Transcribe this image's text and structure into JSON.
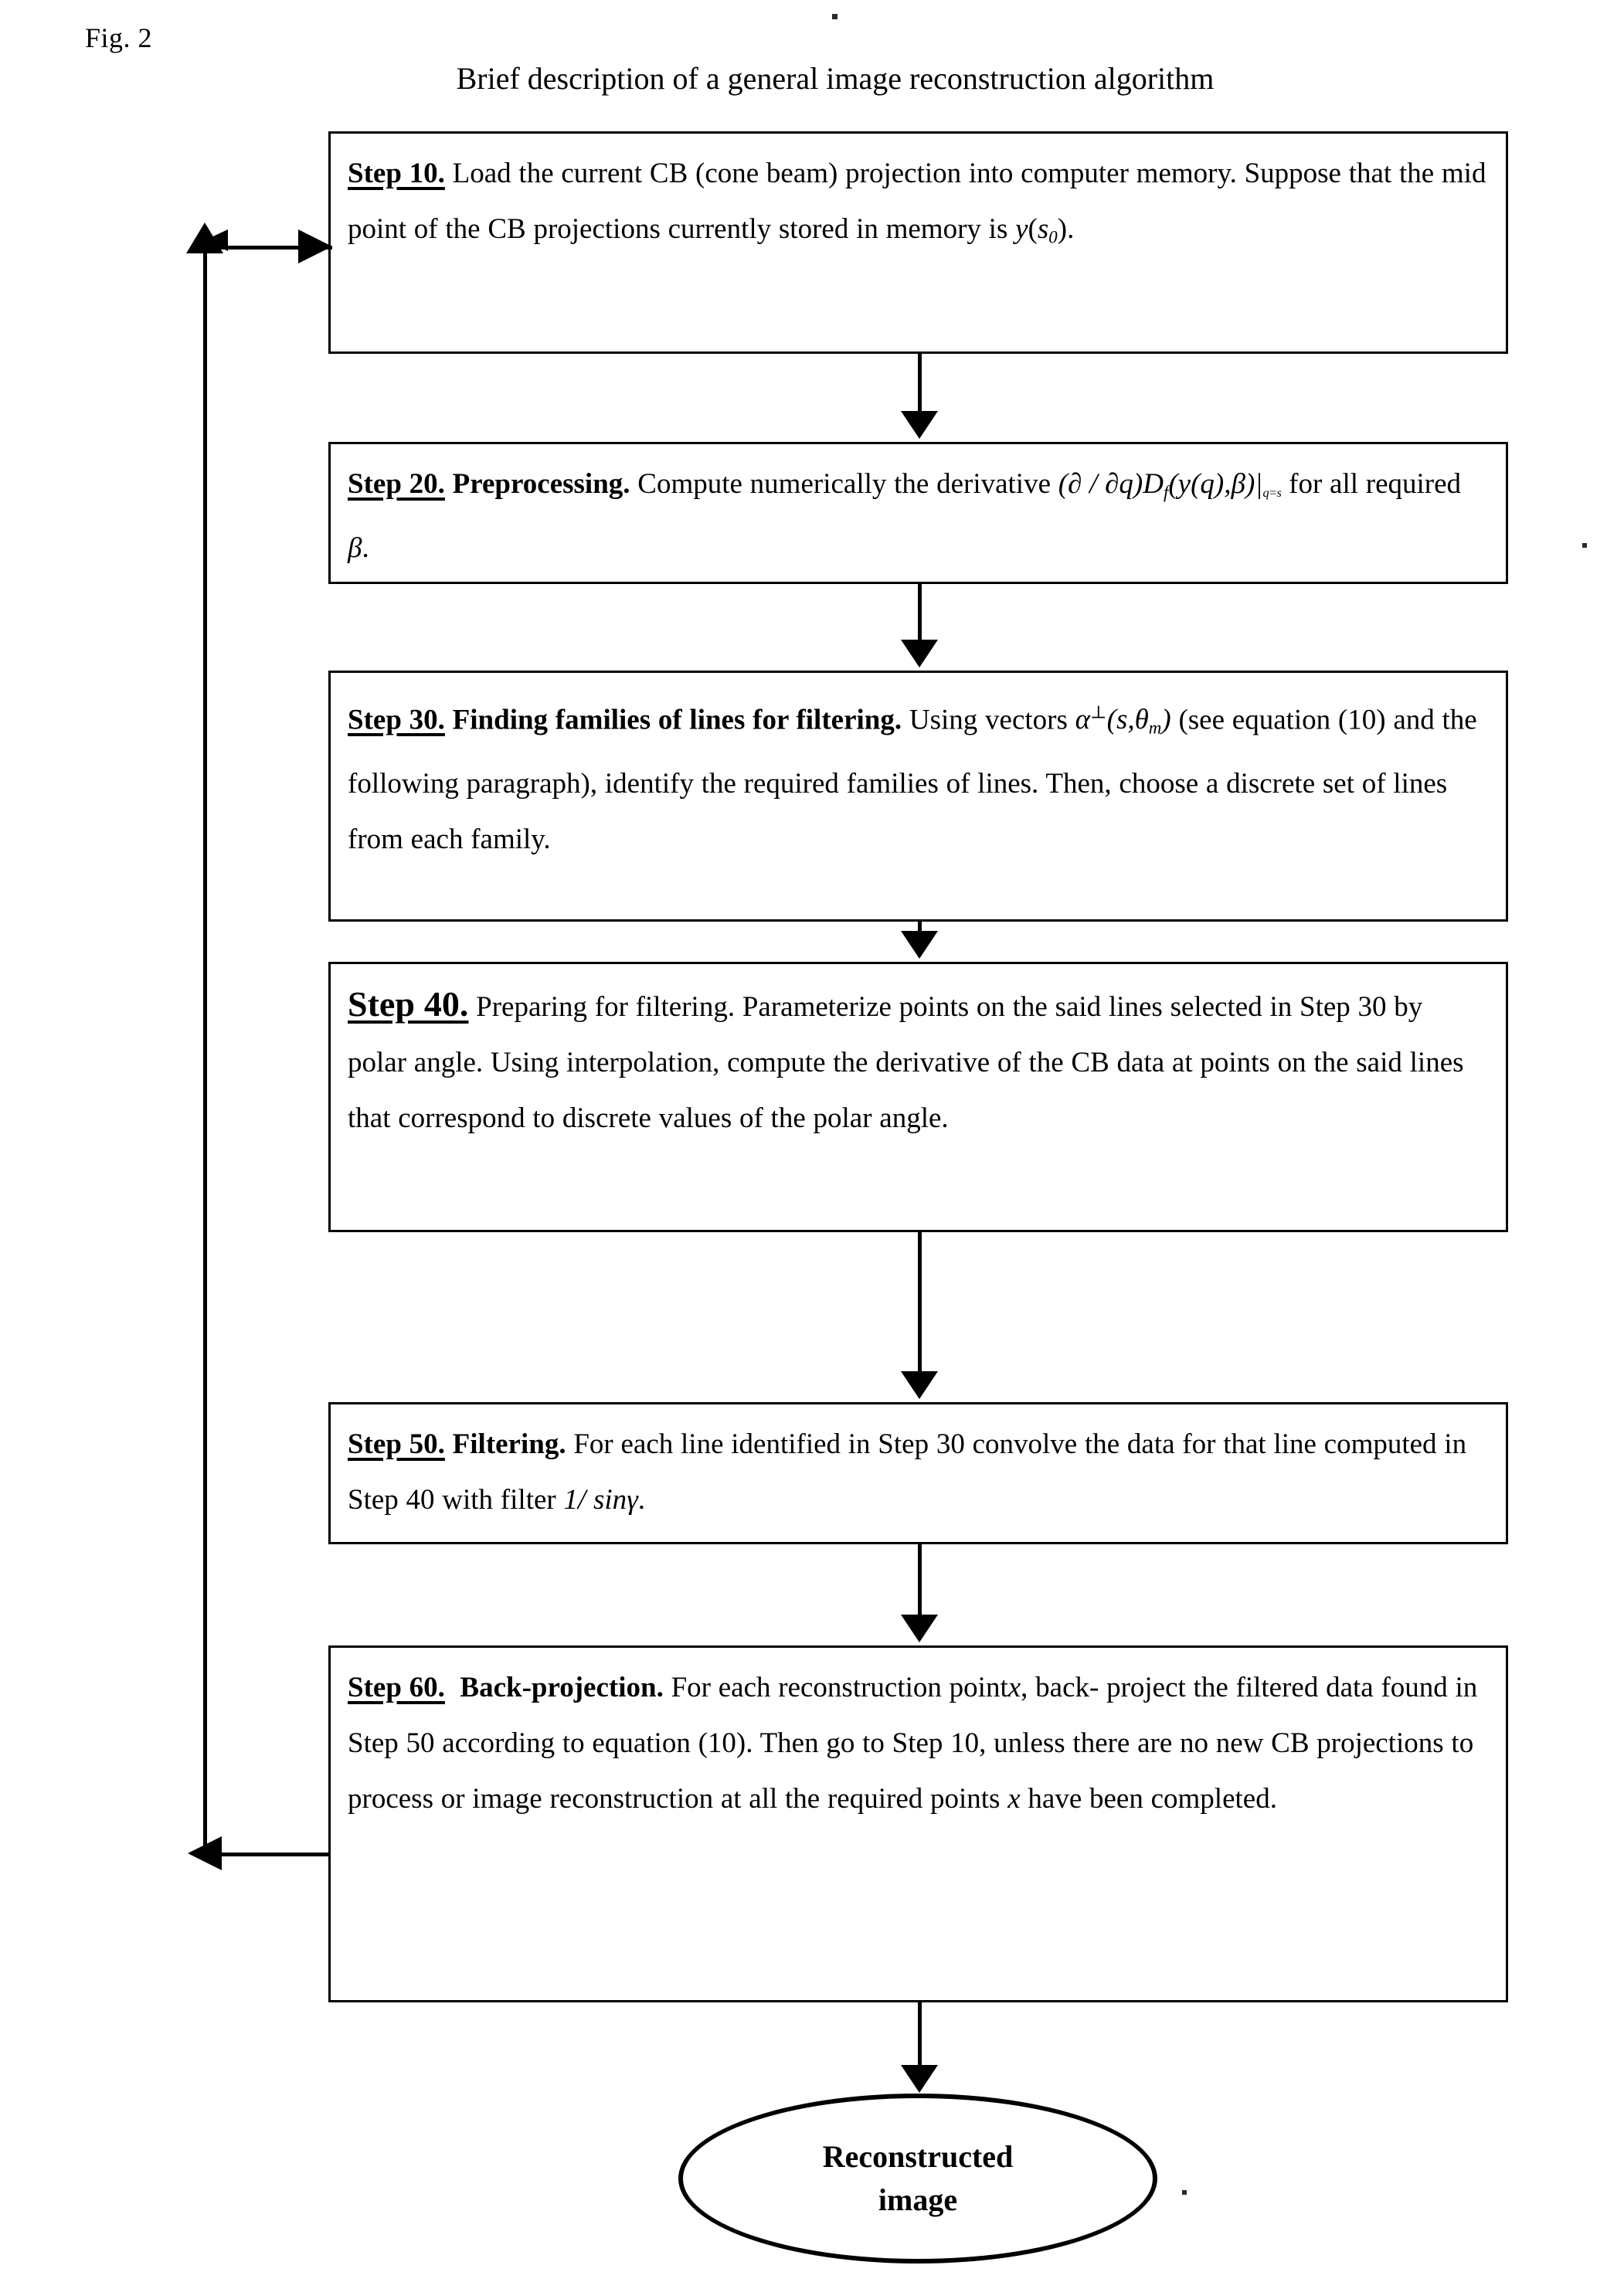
{
  "figure": {
    "label": "Fig. 2",
    "title": "Brief description of a general image reconstruction algorithm"
  },
  "steps": [
    {
      "id": "step10",
      "number": "Step 10.",
      "heading": "",
      "body_line1": "Load the current CB (cone beam) projection into computer",
      "body_line2": "memory. Suppose that the mid point of the CB projections currently",
      "body_line3_pre": "stored in memory is ",
      "math_y": "y",
      "math_s": "s",
      "math_s_sub": "0",
      "body_line3_post": "."
    },
    {
      "id": "step20",
      "number": "Step 20.",
      "heading": "Preprocessing.",
      "body_line1": "Compute numerically the derivative",
      "math_expr_pre": "(∂ / ∂q)D",
      "math_expr_sub": "f",
      "math_expr_mid": "(y(q),",
      "math_beta": "β",
      "math_expr_close": ")",
      "math_eval_bar": "|",
      "math_eval_sub": "q=s",
      "body_line2_mid": " for all required ",
      "body_line2_end": "."
    },
    {
      "id": "step30",
      "number": "Step 30.",
      "heading": "Finding families of lines for filtering.",
      "body_line1": "Using vectors",
      "math_alpha": "α",
      "math_perp": "⊥",
      "math_args_open": "(s,",
      "math_theta": "θ",
      "math_theta_sub": "m",
      "math_args_close": ")",
      "body_line2": " (see equation (10) and the following paragraph), identify the",
      "body_line3": "required families of lines. Then, choose a discrete set of lines from each",
      "body_line4": "family."
    },
    {
      "id": "step40",
      "number": "Step 40.",
      "heading": "Preparing for filtering.",
      "body_line1": "Parameterize points on the said",
      "body_line2": "lines selected in Step 30 by polar angle. Using interpolation, compute",
      "body_line3": "the derivative of the CB data at points on the said lines that correspond",
      "body_line4": "to discrete values of the polar angle."
    },
    {
      "id": "step50",
      "number": "Step 50.",
      "heading": "Filtering.",
      "body_line1": "For each line identified in Step 30 convolve the data",
      "body_line2_pre": "for that line computed in Step 40 with filter ",
      "math_filter": "1/ sin",
      "math_gamma": "γ",
      "body_line2_post": "."
    },
    {
      "id": "step60",
      "number": "Step 60.",
      "heading": "Back-projection.",
      "body_line1_pre": "For each reconstruction point",
      "math_x": "x",
      "body_line1_post": ", back-",
      "body_line2": "project the filtered data found in Step 50 according to equation (10).",
      "body_line3": "Then go to Step 10, unless there are no new CB projections to process",
      "body_line4_pre": "or image reconstruction at all the required points ",
      "body_line4_post": " have been",
      "body_line5": "completed."
    }
  ],
  "terminator": {
    "line1": "Reconstructed",
    "line2": "image"
  },
  "connectors": {
    "feedback_note": "Step 60 back to Step 10"
  },
  "colors": {
    "ink": "#000000",
    "paper": "#ffffff"
  }
}
